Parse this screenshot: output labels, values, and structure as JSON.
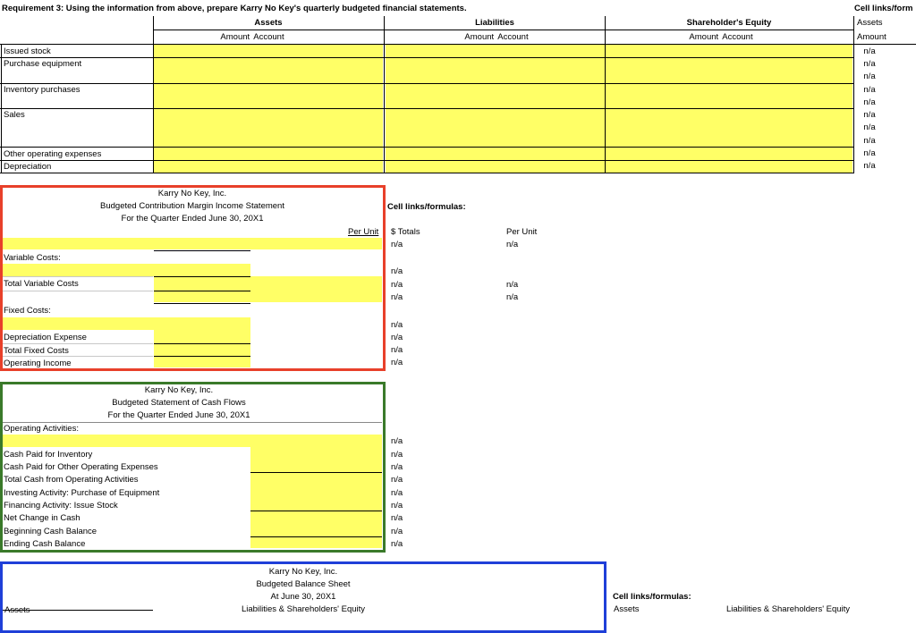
{
  "requirement": "Requirement 3: Using the information from above, prepare Karry No Key's quarterly budgeted financial statements.",
  "top_table": {
    "headers": [
      "Assets",
      "Liabilities",
      "Shareholder's Equity"
    ],
    "subheader": "Amount  Account",
    "rows": [
      "Issued stock",
      "Purchase equipment",
      "Inventory purchases",
      "Sales",
      "Other operating expenses",
      "Depreciation"
    ],
    "right_title": "Cell links/form",
    "right_assets": "Assets",
    "right_amount": "Amount",
    "right_values": [
      "n/a",
      "n/a",
      "n/a",
      "n/a",
      "n/a",
      "n/a",
      "n/a",
      "n/a",
      "n/a",
      "n/a"
    ]
  },
  "income": {
    "company": "Karry No Key, Inc.",
    "title": "Budgeted Contribution Margin Income Statement",
    "period": "For the Quarter Ended June 30, 20X1",
    "per_unit": "Per Unit",
    "variable_costs": "Variable Costs:",
    "total_variable": "Total Variable Costs",
    "fixed_costs": "Fixed Costs:",
    "depreciation": "Depreciation Expense",
    "total_fixed": "Total Fixed Costs",
    "operating_income": "Operating Income",
    "cell_links": "Cell links/formulas:",
    "totals": "$ Totals",
    "per_unit_col": "Per Unit",
    "totals_values": [
      "n/a",
      "n/a",
      "n/a",
      "n/a",
      "n/a",
      "n/a",
      "n/a",
      "n/a"
    ],
    "per_unit_values": [
      "n/a",
      "n/a",
      "n/a"
    ]
  },
  "cash": {
    "company": "Karry No Key, Inc.",
    "title": "Budgeted Statement of Cash Flows",
    "period": "For the Quarter Ended June 30, 20X1",
    "operating": "Operating Activities:",
    "rows": [
      "Cash Paid for Inventory",
      "Cash Paid for Other Operating Expenses",
      "Total Cash from Operating Activities",
      "Investing Activity: Purchase of Equipment",
      "Financing Activity: Issue Stock",
      "Net Change in Cash",
      "Beginning Cash Balance",
      "Ending Cash Balance"
    ],
    "values": [
      "n/a",
      "n/a",
      "n/a",
      "n/a",
      "n/a",
      "n/a",
      "n/a",
      "n/a",
      "n/a"
    ]
  },
  "balance": {
    "company": "Karry No Key, Inc.",
    "title": "Budgeted Balance Sheet",
    "date": "At June 30, 20X1",
    "liab_eq": "Liabilities & Shareholders' Equity",
    "assets": "Assets",
    "cell_links": "Cell links/formulas:",
    "right_assets": "Assets",
    "right_liab_eq": "Liabilities & Shareholders' Equity"
  },
  "colors": {
    "highlight": "#ffff66",
    "red_frame": "#e8402a",
    "green_frame": "#3a7a2a",
    "blue_frame": "#1f3fd8"
  }
}
